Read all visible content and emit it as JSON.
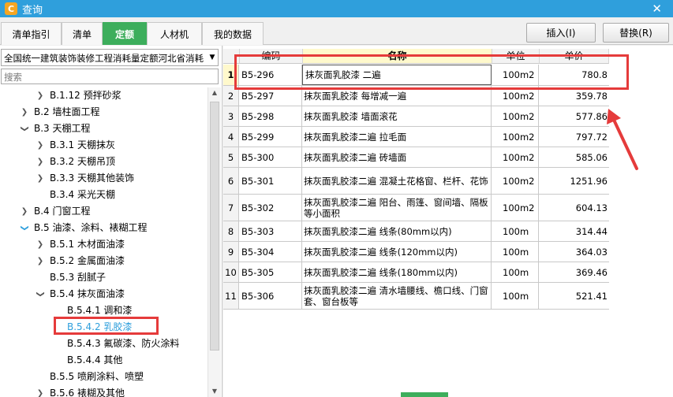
{
  "window": {
    "title": "查询",
    "app_icon_glyph": "C"
  },
  "tabs": [
    {
      "label": "清单指引"
    },
    {
      "label": "清单"
    },
    {
      "label": "定额",
      "active": true
    },
    {
      "label": "人材机"
    },
    {
      "label": "我的数据"
    }
  ],
  "buttons": {
    "insert": "插入(I)",
    "replace": "替换(R)"
  },
  "left": {
    "quota_select": "全国统一建筑装饰装修工程消耗量定额河北省消耗",
    "search_placeholder": "搜索",
    "tree": [
      {
        "label": "B.1.12 预拌砂浆",
        "level": 2,
        "toggle": "collapsed"
      },
      {
        "label": "B.2 墙柱面工程",
        "level": 1,
        "toggle": "collapsed"
      },
      {
        "label": "B.3 天棚工程",
        "level": 1,
        "toggle": "expanded"
      },
      {
        "label": "B.3.1 天棚抹灰",
        "level": 2,
        "toggle": "collapsed"
      },
      {
        "label": "B.3.2 天棚吊顶",
        "level": 2,
        "toggle": "collapsed"
      },
      {
        "label": "B.3.3 天棚其他装饰",
        "level": 2,
        "toggle": "collapsed"
      },
      {
        "label": "B.3.4 采光天棚",
        "level": 2,
        "toggle": "none"
      },
      {
        "label": "B.4 门窗工程",
        "level": 1,
        "toggle": "collapsed"
      },
      {
        "label": "B.5 油漆、涂料、裱糊工程",
        "level": 1,
        "toggle": "expanded-blue"
      },
      {
        "label": "B.5.1 木材面油漆",
        "level": 2,
        "toggle": "collapsed"
      },
      {
        "label": "B.5.2 金属面油漆",
        "level": 2,
        "toggle": "collapsed"
      },
      {
        "label": "B.5.3 刮腻子",
        "level": 2,
        "toggle": "none"
      },
      {
        "label": "B.5.4 抹灰面油漆",
        "level": 2,
        "toggle": "expanded"
      },
      {
        "label": "B.5.4.1 调和漆",
        "level": 3,
        "toggle": "none"
      },
      {
        "label": "B.5.4.2 乳胶漆",
        "level": 3,
        "toggle": "none",
        "selected": true
      },
      {
        "label": "B.5.4.3 氟碳漆、防火涂料",
        "level": 3,
        "toggle": "none"
      },
      {
        "label": "B.5.4.4 其他",
        "level": 3,
        "toggle": "none"
      },
      {
        "label": "B.5.5 喷刷涂料、喷塑",
        "level": 2,
        "toggle": "none"
      },
      {
        "label": "B.5.6 裱糊及其他",
        "level": 2,
        "toggle": "collapsed"
      }
    ]
  },
  "table": {
    "columns": {
      "index": "",
      "code": "编码",
      "name": "名称",
      "unit": "单位",
      "price": "单价"
    },
    "rows": [
      {
        "index": "1",
        "code": "B5-296",
        "name": "抹灰面乳胶漆 二遍",
        "unit": "100m2",
        "price": "780.8",
        "selected": true
      },
      {
        "index": "2",
        "code": "B5-297",
        "name": "抹灰面乳胶漆 每增减一遍",
        "unit": "100m2",
        "price": "359.78"
      },
      {
        "index": "3",
        "code": "B5-298",
        "name": "抹灰面乳胶漆 墙面滚花",
        "unit": "100m2",
        "price": "577.86"
      },
      {
        "index": "4",
        "code": "B5-299",
        "name": "抹灰面乳胶漆二遍 拉毛面",
        "unit": "100m2",
        "price": "797.72"
      },
      {
        "index": "5",
        "code": "B5-300",
        "name": "抹灰面乳胶漆二遍 砖墙面",
        "unit": "100m2",
        "price": "585.06"
      },
      {
        "index": "6",
        "code": "B5-301",
        "name": "抹灰面乳胶漆二遍 混凝土花格窗、栏杆、花饰",
        "unit": "100m2",
        "price": "1251.96"
      },
      {
        "index": "7",
        "code": "B5-302",
        "name": "抹灰面乳胶漆二遍 阳台、雨篷、窗间墙、隔板等小面积",
        "unit": "100m2",
        "price": "604.13"
      },
      {
        "index": "8",
        "code": "B5-303",
        "name": "抹灰面乳胶漆二遍 线条(80mm以内)",
        "unit": "100m",
        "price": "314.44"
      },
      {
        "index": "9",
        "code": "B5-304",
        "name": "抹灰面乳胶漆二遍 线条(120mm以内)",
        "unit": "100m",
        "price": "364.03"
      },
      {
        "index": "10",
        "code": "B5-305",
        "name": "抹灰面乳胶漆二遍 线条(180mm以内)",
        "unit": "100m",
        "price": "369.46"
      },
      {
        "index": "11",
        "code": "B5-306",
        "name": "抹灰面乳胶漆二遍 清水墙腰线、檐口线、门窗套、窗台板等",
        "unit": "100m",
        "price": "521.41"
      }
    ]
  },
  "colors": {
    "titlebar": "#2f9fdc",
    "active_tab": "#3dae5c",
    "annotation": "#e53b3b",
    "selected_tree": "#2f9fdc"
  }
}
